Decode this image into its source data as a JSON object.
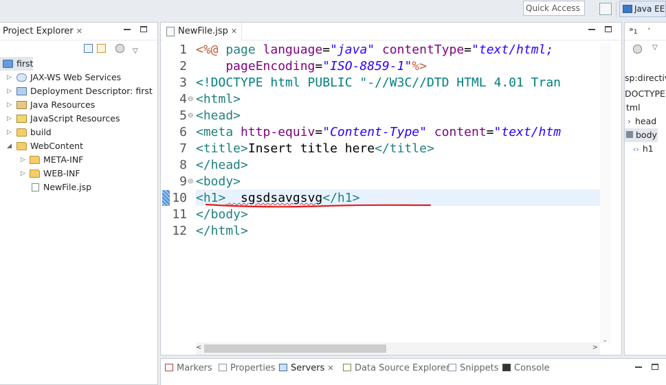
{
  "toolbar": {
    "quick_access_placeholder": "Quick Access",
    "perspective_label": "Java EE"
  },
  "project_explorer": {
    "title": "Project Explorer",
    "close": "✕",
    "tree": [
      {
        "label": "first",
        "icon": "project-icon",
        "arrow": "▾",
        "selected": true
      },
      {
        "label": "JAX-WS Web Services",
        "icon": "web-services-icon",
        "arrow": "▷"
      },
      {
        "label": "Deployment Descriptor: first",
        "icon": "deployment-descriptor-icon",
        "arrow": "▷"
      },
      {
        "label": "Java Resources",
        "icon": "java-resources-icon",
        "arrow": "▷"
      },
      {
        "label": "JavaScript Resources",
        "icon": "javascript-resources-icon",
        "arrow": "▷"
      },
      {
        "label": "build",
        "icon": "folder-icon",
        "arrow": "▷"
      },
      {
        "label": "WebContent",
        "icon": "folder-open-icon",
        "arrow": "◢"
      },
      {
        "label": "META-INF",
        "icon": "folder-icon",
        "arrow": "▷"
      },
      {
        "label": "WEB-INF",
        "icon": "folder-icon",
        "arrow": "▷"
      },
      {
        "label": "NewFile.jsp",
        "icon": "jsp-file-icon",
        "arrow": ""
      }
    ]
  },
  "editor": {
    "tab_label": "NewFile.jsp",
    "close": "✕",
    "line_numbers": [
      "1",
      "2",
      "3",
      "4",
      "5",
      "6",
      "7",
      "8",
      "9",
      "10",
      "11",
      "12"
    ],
    "fold_markers": {
      "4": "⊖",
      "5": "⊖",
      "9": "⊖"
    },
    "lines": {
      "l1": {
        "open": "<%@",
        "kw1": " page ",
        "a1": "language",
        "eq1": "=",
        "v1": "\"java\"",
        "a2": " contentType",
        "eq2": "=",
        "v2": "\"text/html;"
      },
      "l2": {
        "a1": "    pageEncoding",
        "eq1": "=",
        "v1": "\"ISO-8859-1\"",
        "close": "%>"
      },
      "l3": {
        "text": "<!DOCTYPE html PUBLIC \"-//W3C//DTD HTML 4.01 Tran"
      },
      "l4": {
        "text": "<html>"
      },
      "l5": {
        "text": "<head>"
      },
      "l6": {
        "tag": "<meta",
        "a1": " http-equiv",
        "eq1": "=",
        "v1": "\"Content-Type\"",
        "a2": " content",
        "eq2": "=",
        "v2": "\"text/htm"
      },
      "l7": {
        "open": "<title>",
        "content": "Insert title here",
        "close": "</title>"
      },
      "l8": {
        "text": "</head>"
      },
      "l9": {
        "text": "<body>"
      },
      "l10": {
        "open": "<h1>",
        "content": "  sgsdsavgsvg",
        "close": "</h1>"
      },
      "l11": {
        "text": "</body>"
      },
      "l12": {
        "text": "</html>"
      }
    }
  },
  "outline": {
    "items": [
      "sp:directive",
      "DOCTYPE:h",
      "tml",
      "head",
      "body",
      "h1"
    ],
    "arrow_collapsed": "›",
    "arrow_expanded": "‹›"
  },
  "bottom_tabs": [
    {
      "label": "Markers",
      "active": false
    },
    {
      "label": "Properties",
      "active": false
    },
    {
      "label": "Servers",
      "active": true,
      "close": "✕"
    },
    {
      "label": "Data Source Explorer",
      "active": false
    },
    {
      "label": "Snippets",
      "active": false
    },
    {
      "label": "Console",
      "active": false
    }
  ],
  "colors": {
    "tag": "#1f7f7f",
    "attr": "#7f007f",
    "value": "#2a00ff",
    "jsp": "#bf5f3f",
    "annotation": "#e02020"
  }
}
